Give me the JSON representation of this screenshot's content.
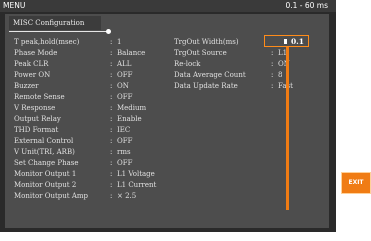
{
  "title_bar": {
    "title": "MENU",
    "range": "0.1 - 60 ms"
  },
  "tab": {
    "label": "MISC Configuration"
  },
  "left_settings": [
    {
      "label": "T peak,hold(msec)",
      "value": "1"
    },
    {
      "label": "Phase Mode",
      "value": "Balance"
    },
    {
      "label": "Peak CLR",
      "value": "ALL"
    },
    {
      "label": "Power ON",
      "value": "OFF"
    },
    {
      "label": "Buzzer",
      "value": "ON"
    },
    {
      "label": "Remote Sense",
      "value": "OFF"
    },
    {
      "label": "V Response",
      "value": "Medium"
    },
    {
      "label": "Output Relay",
      "value": "Enable"
    },
    {
      "label": "THD Format",
      "value": "IEC"
    },
    {
      "label": "External Control",
      "value": "OFF"
    },
    {
      "label": "V Unit(TRI, ARB)",
      "value": "rms"
    },
    {
      "label": "Set Change Phase",
      "value": "OFF"
    },
    {
      "label": "Monitor Output 1",
      "value": "L1 Voltage"
    },
    {
      "label": "Monitor Output 2",
      "value": "L1 Current"
    },
    {
      "label": "Monitor Output Amp",
      "value": "× 2.5"
    }
  ],
  "right_settings": [
    {
      "label": "TrgOut Width(ms)",
      "value": "0.1"
    },
    {
      "label": "TrgOut Source",
      "value": "L1"
    },
    {
      "label": "Re-lock",
      "value": "ON"
    },
    {
      "label": "Data Average Count",
      "value": "8"
    },
    {
      "label": "Data Update Rate",
      "value": "Fast"
    }
  ],
  "separator": ":",
  "exit_button": {
    "label": "EXIT"
  },
  "colors": {
    "accent": "#f07c14",
    "background": "#2a2a2a",
    "panel": "#4d4d4d"
  }
}
